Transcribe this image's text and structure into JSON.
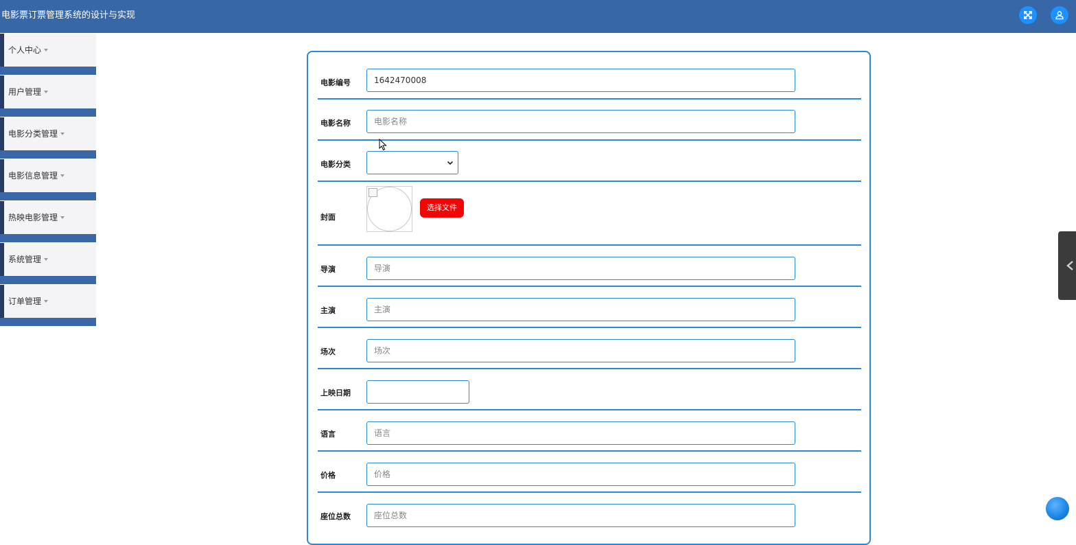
{
  "app": {
    "title": "电影票订票管理系统的设计与实现"
  },
  "header": {
    "icons": [
      "fullscreen-icon",
      "user-icon"
    ]
  },
  "sidebar": {
    "items": [
      {
        "label": "个人中心"
      },
      {
        "label": "用户管理"
      },
      {
        "label": "电影分类管理"
      },
      {
        "label": "电影信息管理"
      },
      {
        "label": "热映电影管理"
      },
      {
        "label": "系统管理"
      },
      {
        "label": "订单管理"
      }
    ]
  },
  "form": {
    "movie_no": {
      "label": "电影编号",
      "value": "1642470008"
    },
    "movie_name": {
      "label": "电影名称",
      "placeholder": "电影名称"
    },
    "movie_category": {
      "label": "电影分类",
      "selected": ""
    },
    "cover": {
      "label": "封面",
      "button": "选择文件"
    },
    "director": {
      "label": "导演",
      "placeholder": "导演"
    },
    "cast": {
      "label": "主演",
      "placeholder": "主演"
    },
    "session": {
      "label": "场次",
      "placeholder": "场次"
    },
    "release_date": {
      "label": "上映日期",
      "value": ""
    },
    "language": {
      "label": "语言",
      "placeholder": "语言"
    },
    "price": {
      "label": "价格",
      "placeholder": "价格"
    },
    "seats": {
      "label": "座位总数",
      "placeholder": "座位总数"
    }
  },
  "colors": {
    "topbar": "#3867a8",
    "accent": "#2b87d8",
    "sidebar_border": "#273a63",
    "file_button": "#f20505"
  }
}
